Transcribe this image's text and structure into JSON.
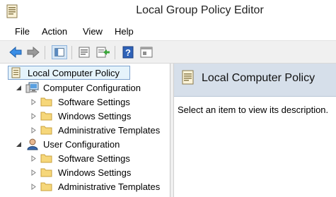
{
  "window": {
    "title": "Local Group Policy Editor"
  },
  "menu": [
    "File",
    "Action",
    "View",
    "Help"
  ],
  "toolbar": [
    "back-arrow-icon",
    "forward-arrow-icon",
    "show-hide-tree-icon",
    "properties-icon",
    "export-list-icon",
    "help-icon",
    "view-icon"
  ],
  "tree": {
    "root": "Local Computer Policy",
    "computer": {
      "label": "Computer Configuration",
      "children": [
        "Software Settings",
        "Windows Settings",
        "Administrative Templates"
      ]
    },
    "user": {
      "label": "User Configuration",
      "children": [
        "Software Settings",
        "Windows Settings",
        "Administrative Templates"
      ]
    }
  },
  "right_pane": {
    "title": "Local Computer Policy",
    "description": "Select an item to view its description."
  }
}
